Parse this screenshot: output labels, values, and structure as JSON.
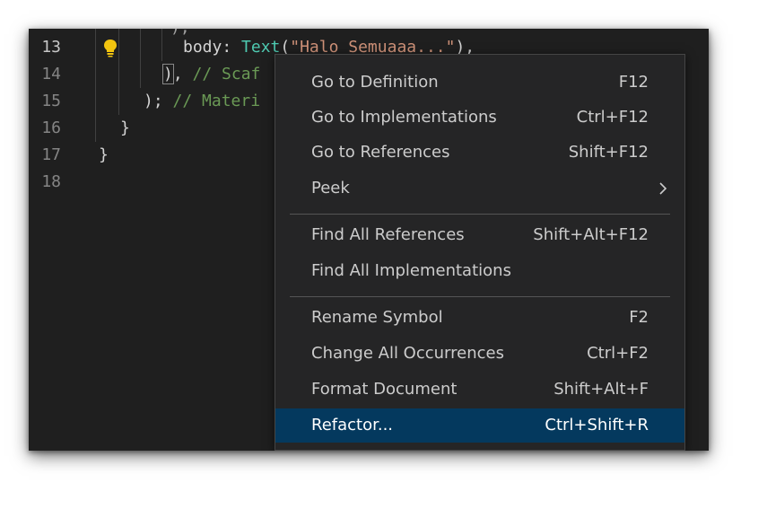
{
  "editor": {
    "lines": [
      {
        "num": "13",
        "indent": "      ",
        "prefix": "body: ",
        "fn": "Text",
        "open": "(",
        "str": "\"Halo Semuaaa...\"",
        "close": "),"
      },
      {
        "num": "14",
        "indent": "    ",
        "bracket": ")",
        "comma": ",",
        "comment": "// Scaf"
      },
      {
        "num": "15",
        "indent": "  ",
        "code": ");",
        "comment": "// Materi"
      },
      {
        "num": "16",
        "code": "}"
      },
      {
        "num": "17",
        "code": "}"
      },
      {
        "num": "18",
        "code": ""
      }
    ]
  },
  "context_menu": {
    "groups": [
      [
        {
          "label": "Go to Definition",
          "shortcut": "F12"
        },
        {
          "label": "Go to Implementations",
          "shortcut": "Ctrl+F12"
        },
        {
          "label": "Go to References",
          "shortcut": "Shift+F12"
        },
        {
          "label": "Peek",
          "shortcut": ""
        }
      ],
      [
        {
          "label": "Find All References",
          "shortcut": "Shift+Alt+F12"
        },
        {
          "label": "Find All Implementations",
          "shortcut": ""
        }
      ],
      [
        {
          "label": "Rename Symbol",
          "shortcut": "F2"
        },
        {
          "label": "Change All Occurrences",
          "shortcut": "Ctrl+F2"
        },
        {
          "label": "Format Document",
          "shortcut": "Shift+Alt+F"
        },
        {
          "label": "Refactor...",
          "shortcut": "Ctrl+Shift+R"
        }
      ]
    ],
    "selected": "Refactor..."
  },
  "colors": {
    "editor_bg": "#1f1f1f",
    "menu_bg": "#252526",
    "selection_bg": "#04395e",
    "string": "#ce9178",
    "type": "#4ec9b0",
    "comment": "#6a9955"
  },
  "icons": {
    "lightbulb": "lightbulb-icon",
    "submenu": "chevron-right-icon"
  }
}
